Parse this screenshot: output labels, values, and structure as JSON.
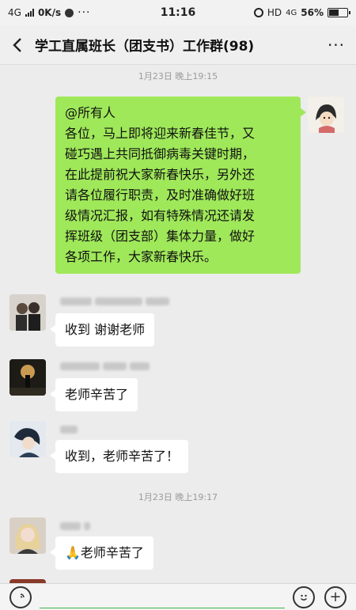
{
  "status_bar": {
    "network": "4G",
    "speed": "0K/s",
    "time": "11:16",
    "hd": "HD",
    "network_right": "4G",
    "battery_percent": "56%",
    "battery_level": 0.56
  },
  "header": {
    "back_icon": "chevron-left-icon",
    "title": "学工直属班长（团支书）工作群(98)",
    "more_icon": "more-icon"
  },
  "chat": {
    "timestamps": [
      "1月23日 晚上19:15",
      "1月23日 晚上19:17"
    ],
    "messages": [
      {
        "sender": "me",
        "lines": [
          "@所有人",
          "各位，马上即将迎来新春佳节，又",
          "碰巧遇上共同抵御病毒关键时期，",
          "在此提前祝大家新春快乐，另外还",
          "请各位履行职责，及时准确做好班",
          "级情况汇报，如有特殊情况还请发",
          "挥班级（团支部）集体力量，做好",
          "各项工作，大家新春快乐。"
        ]
      },
      {
        "sender": "other",
        "text": "收到 谢谢老师"
      },
      {
        "sender": "other",
        "text": "老师辛苦了"
      },
      {
        "sender": "other",
        "text": "收到，老师辛苦了！"
      },
      {
        "sender": "other",
        "emoji": "🙏",
        "text": "老师辛苦了"
      }
    ]
  },
  "input_bar": {
    "voice_icon": "voice-icon",
    "emoji_icon": "emoji-icon",
    "add_icon": "plus-icon"
  },
  "colors": {
    "chat_bg": "#ececec",
    "my_bubble": "#9fe85a",
    "other_bubble": "#ffffff"
  }
}
